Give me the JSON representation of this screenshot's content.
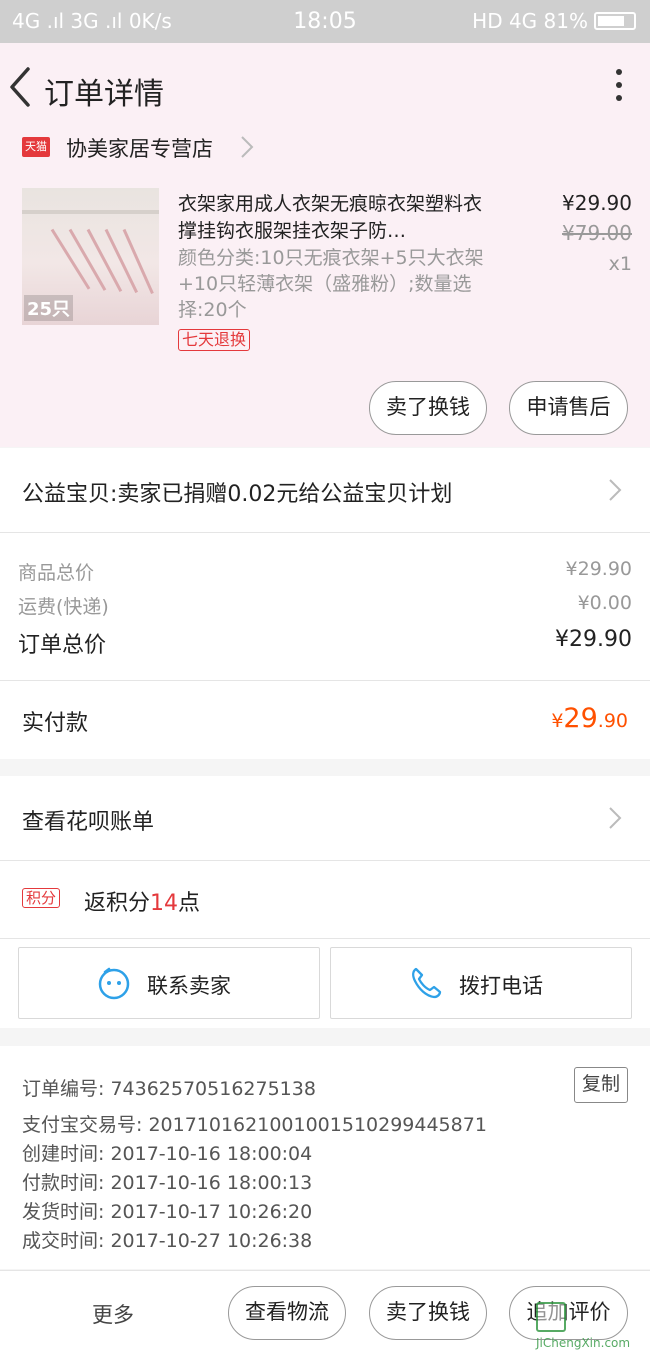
{
  "status_bar": {
    "left": "4G .ıl 3G .ıl 0K/s",
    "time": "18:05",
    "right": "HD 4G 81%"
  },
  "nav": {
    "title": "订单详情"
  },
  "shop": {
    "badge": "天猫",
    "name": "协美家居专营店"
  },
  "product": {
    "thumb_count": "25只",
    "title": "衣架家用成人衣架无痕晾衣架塑料衣撑挂钩衣服架挂衣架子防…",
    "spec": "颜色分类:10只无痕衣架+5只大衣架+10只轻薄衣架（盛雅粉）;数量选择:20个",
    "return_tag": "七天退换",
    "price_now": "¥29.90",
    "price_old": "¥79.00",
    "qty": "x1",
    "btn_sell": "卖了换钱",
    "btn_aftersale": "申请售后"
  },
  "charity": {
    "text": "公益宝贝:卖家已捐赠0.02元给公益宝贝计划"
  },
  "summary": {
    "goods_label": "商品总价",
    "goods_value": "¥29.90",
    "shipping_label": "运费(快递)",
    "shipping_value": "¥0.00",
    "total_label": "订单总价",
    "total_value": "¥29.90"
  },
  "paid": {
    "label": "实付款",
    "currency": "¥",
    "integer": "29",
    "decimal": ".90"
  },
  "huabei": {
    "text": "查看花呗账单"
  },
  "points": {
    "tag": "积分",
    "prefix": "返积分",
    "value": "14",
    "suffix": "点"
  },
  "contact": {
    "seller": "联系卖家",
    "phone": "拨打电话"
  },
  "order_info": {
    "order_no": "订单编号: 74362570516275138",
    "copy_label": "复制",
    "alipay_no": "支付宝交易号: 2017101621001001510299445871",
    "created": "创建时间: 2017-10-16 18:00:04",
    "paid": "付款时间: 2017-10-16 18:00:13",
    "shipped": "发货时间: 2017-10-17 10:26:20",
    "completed": "成交时间: 2017-10-27 10:26:38"
  },
  "bottom": {
    "more": "更多",
    "logistics": "查看物流",
    "sell": "卖了换钱",
    "review": "追加评价"
  },
  "watermark": {
    "text": "JiChengXin.com"
  },
  "colors": {
    "accent": "#ff5000",
    "tmall_red": "#e4393c",
    "nav_bg": "#fbf0f5"
  }
}
